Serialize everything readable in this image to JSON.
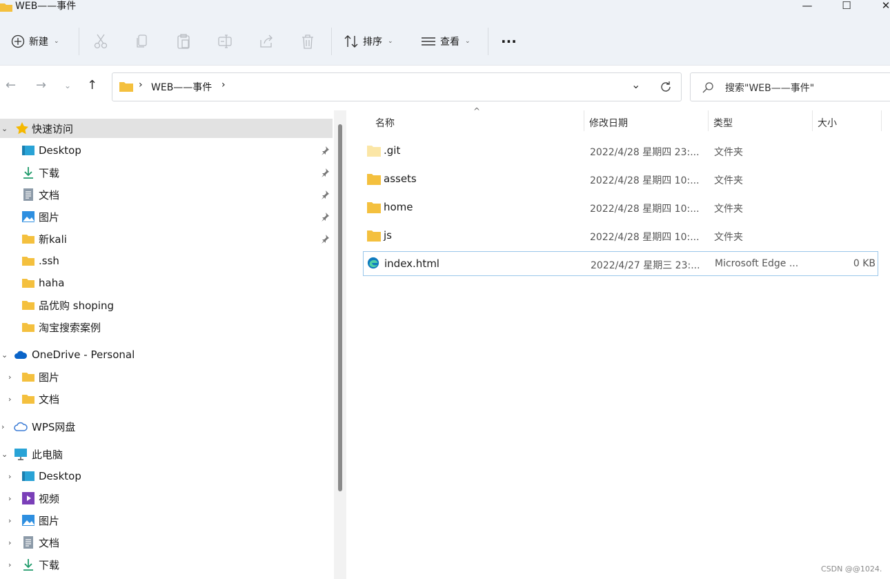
{
  "window": {
    "title": "WEB——事件",
    "minimize": "—",
    "maximize": "☐",
    "close": "✕"
  },
  "toolbar": {
    "new_label": "新建",
    "sort_label": "排序",
    "view_label": "查看",
    "more_label": "···"
  },
  "address": {
    "path": "WEB——事件",
    "separator": "›",
    "search_placeholder": "搜索\"WEB——事件\""
  },
  "sidebar": {
    "quick_access": "快速访问",
    "quick_items": [
      "Desktop",
      "下载",
      "文档",
      "图片",
      "新kali",
      ".ssh",
      "haha",
      "品优购 shoping",
      "淘宝搜索案例"
    ],
    "onedrive": "OneDrive - Personal",
    "onedrive_items": [
      "图片",
      "文档"
    ],
    "wps": "WPS网盘",
    "this_pc": "此电脑",
    "pc_items": [
      "Desktop",
      "视频",
      "图片",
      "文档",
      "下载"
    ]
  },
  "columns": {
    "name": "名称",
    "date": "修改日期",
    "type": "类型",
    "size": "大小"
  },
  "files": [
    {
      "name": ".git",
      "date": "2022/4/28 星期四 23:...",
      "type": "文件夹",
      "size": ""
    },
    {
      "name": "assets",
      "date": "2022/4/28 星期四 10:...",
      "type": "文件夹",
      "size": ""
    },
    {
      "name": "home",
      "date": "2022/4/28 星期四 10:...",
      "type": "文件夹",
      "size": ""
    },
    {
      "name": "js",
      "date": "2022/4/28 星期四 10:...",
      "type": "文件夹",
      "size": ""
    },
    {
      "name": "index.html",
      "date": "2022/4/27 星期三 23:...",
      "type": "Microsoft Edge ...",
      "size": "0 KB"
    }
  ],
  "watermark": "CSDN @@1024.",
  "colors": {
    "folder": "#f4c03e",
    "accent": "#0a64c8",
    "selection": "#99c6ea"
  }
}
